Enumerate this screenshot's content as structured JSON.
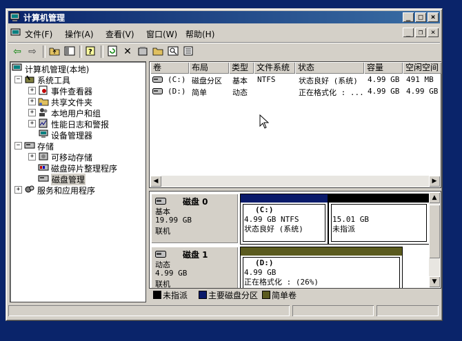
{
  "window": {
    "title": "计算机管理"
  },
  "menu": [
    "文件(F)",
    "操作(A)",
    "查看(V)",
    "窗口(W)",
    "帮助(H)"
  ],
  "tree": {
    "root": "计算机管理(本地)",
    "system_tools": "系统工具",
    "event_viewer": "事件查看器",
    "shared_folders": "共享文件夹",
    "local_users": "本地用户和组",
    "perf_logs": "性能日志和警报",
    "device_manager": "设备管理器",
    "storage": "存储",
    "removable": "可移动存储",
    "defrag": "磁盘碎片整理程序",
    "disk_mgmt": "磁盘管理",
    "services": "服务和应用程序"
  },
  "list": {
    "columns": [
      "卷",
      "布局",
      "类型",
      "文件系统",
      "状态",
      "容量",
      "空闲空间"
    ],
    "rows": [
      [
        "(C:)",
        "磁盘分区",
        "基本",
        "NTFS",
        "状态良好 (系统)",
        "4.99 GB",
        "491 MB"
      ],
      [
        "(D:)",
        "简单",
        "动态",
        "",
        "正在格式化 : ...",
        "4.99 GB",
        "4.99 GB"
      ]
    ]
  },
  "disks": [
    {
      "name": "磁盘 0",
      "type": "基本",
      "size": "19.99 GB",
      "state": "联机",
      "volumes": [
        {
          "label": "(C:)",
          "size": "4.99 GB NTFS",
          "status": "状态良好 (系统)"
        },
        {
          "label": "",
          "size": "15.01 GB",
          "status": "未指派"
        }
      ]
    },
    {
      "name": "磁盘 1",
      "type": "动态",
      "size": "4.99 GB",
      "state": "联机",
      "volumes": [
        {
          "label": "(D:)",
          "size": "4.99 GB",
          "status": "正在格式化 : (26%)"
        }
      ]
    }
  ],
  "legend": [
    "未指派",
    "主要磁盘分区",
    "简单卷"
  ],
  "colors": {
    "unallocated": "#000000",
    "primary": "#0a1a6a",
    "simple": "#5a5a1e"
  }
}
